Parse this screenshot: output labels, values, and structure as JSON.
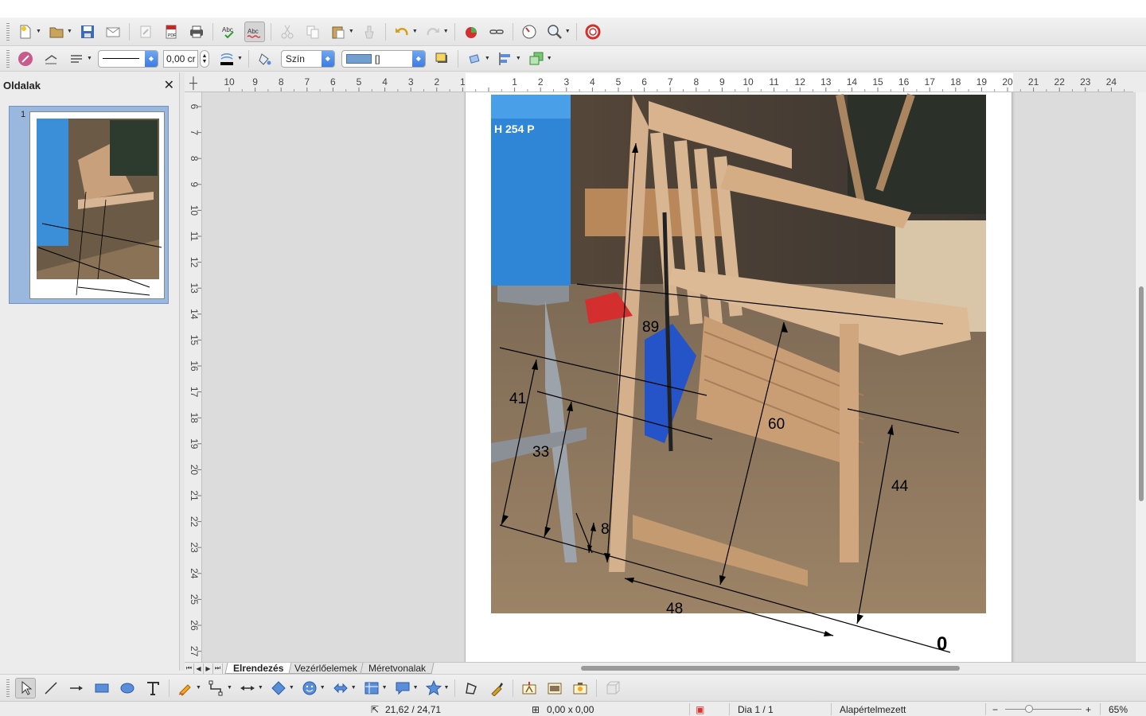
{
  "toolbar_standard": {
    "icons": [
      "new-document-icon",
      "open-folder-icon",
      "save-icon",
      "email-icon",
      "edit-file-icon",
      "export-pdf-icon",
      "print-icon",
      "spellcheck-icon",
      "autospellcheck-icon",
      "cut-icon",
      "copy-icon",
      "paste-icon",
      "clone-formatting-icon",
      "undo-icon",
      "redo-icon",
      "chart-icon",
      "hyperlink-icon",
      "navigator-icon",
      "zoom-icon",
      "help-icon"
    ]
  },
  "toolbar_line_fill": {
    "line_width_value": "0,00 cr",
    "fill_type_label": "Szín",
    "fill_color_value": "[]",
    "line_color": "#000000",
    "fill_color": "#729fcf"
  },
  "sidebar": {
    "title": "Oldalak",
    "close_glyph": "✕",
    "thumbnails": [
      {
        "number": "1"
      }
    ]
  },
  "ruler": {
    "horizontal_ticks": [
      "10",
      "9",
      "8",
      "7",
      "6",
      "5",
      "4",
      "3",
      "2",
      "1",
      "",
      "1",
      "2",
      "3",
      "4",
      "5",
      "6",
      "7",
      "8",
      "9",
      "10",
      "11",
      "12",
      "13",
      "14",
      "15",
      "16",
      "17",
      "18",
      "19",
      "20",
      "21",
      "22",
      "23",
      "24"
    ],
    "vertical_ticks": [
      "6",
      "7",
      "8",
      "9",
      "10",
      "11",
      "12",
      "13",
      "14",
      "15",
      "16",
      "17",
      "18",
      "19",
      "20",
      "21",
      "22",
      "23",
      "24",
      "25",
      "26",
      "27"
    ]
  },
  "drawing": {
    "dimension_labels": [
      "89",
      "41",
      "33",
      "8",
      "60",
      "44",
      "48",
      "0"
    ]
  },
  "tabs": [
    "Elrendezés",
    "Vezérlőelemek",
    "Méretvonalak"
  ],
  "statusbar": {
    "position": "21,62 / 24,71",
    "size": "0,00 x 0,00",
    "slide": "Dia 1 / 1",
    "layout": "Alapértelmezett",
    "zoom": "65%"
  }
}
